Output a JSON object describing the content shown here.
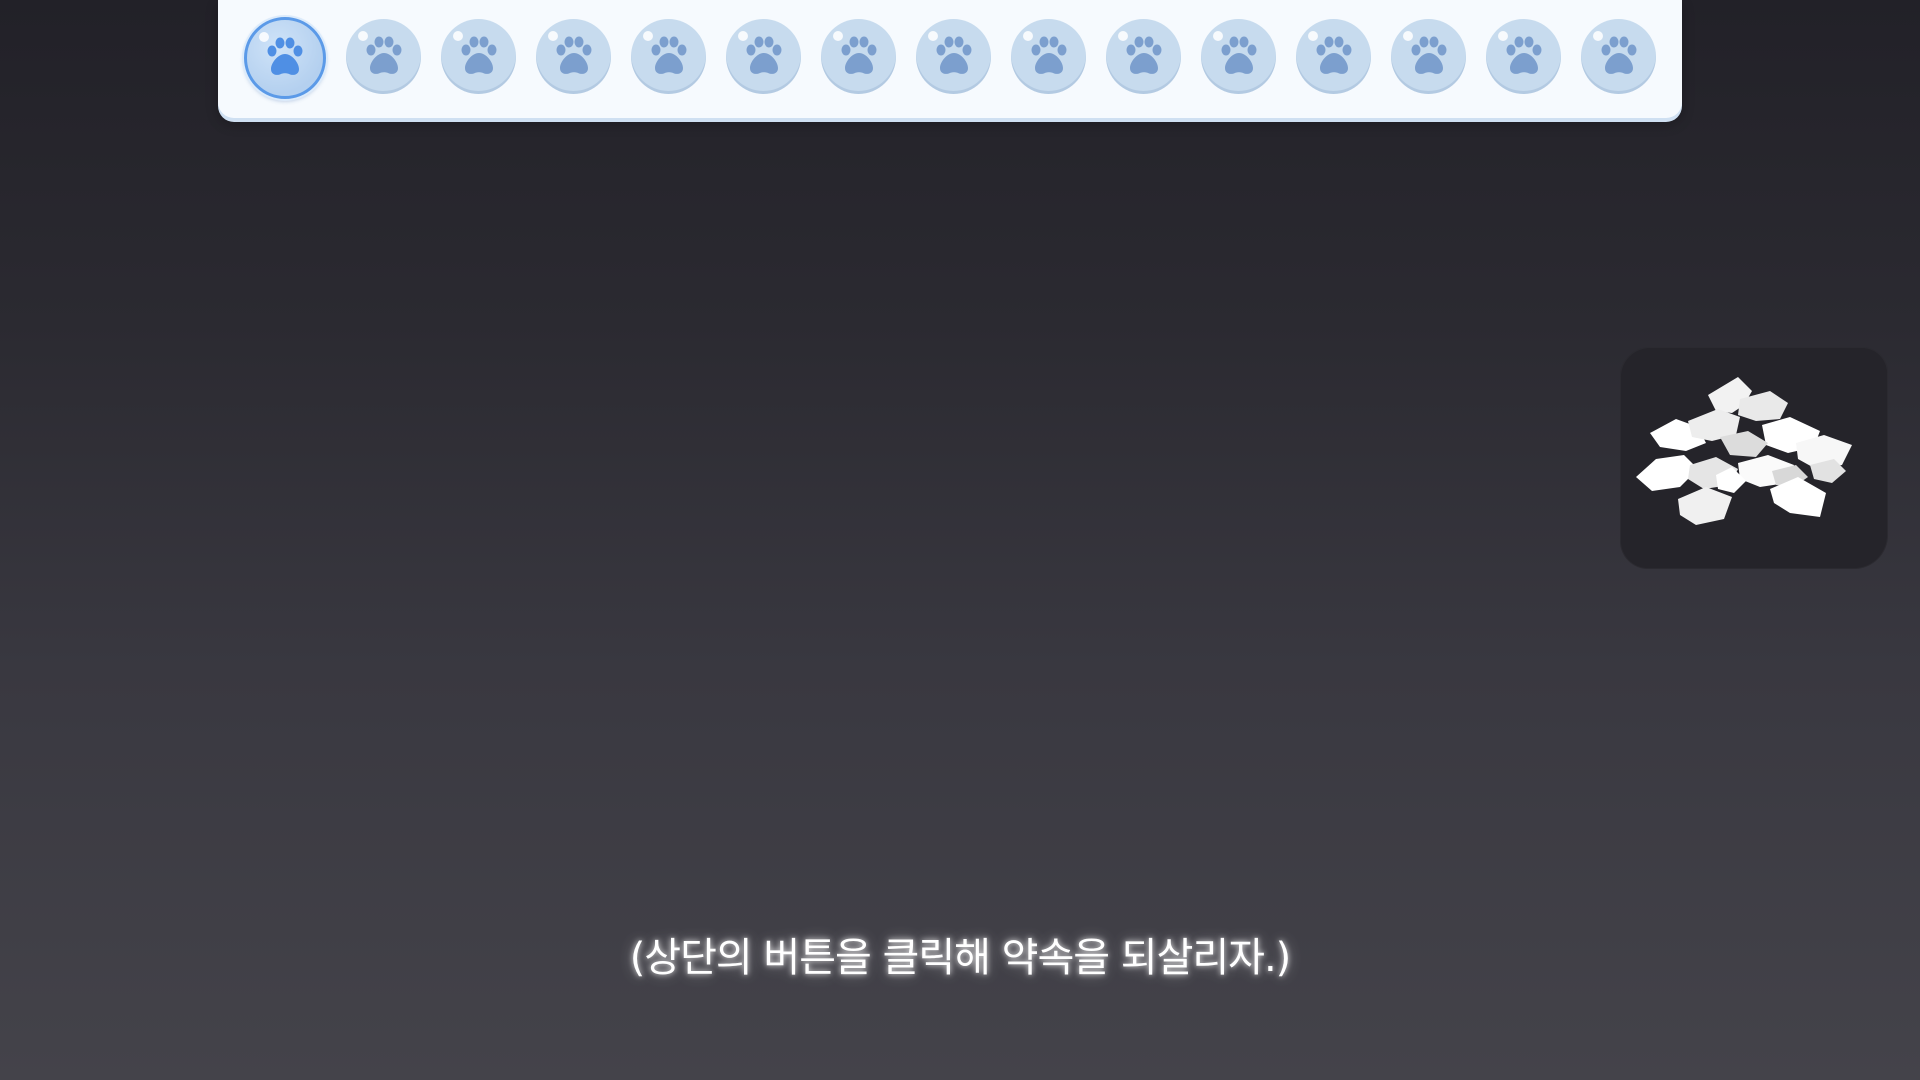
{
  "toolbar": {
    "buttons": [
      {
        "icon": "paw-icon",
        "active": true
      },
      {
        "icon": "paw-icon",
        "active": false
      },
      {
        "icon": "paw-icon",
        "active": false
      },
      {
        "icon": "paw-icon",
        "active": false
      },
      {
        "icon": "paw-icon",
        "active": false
      },
      {
        "icon": "paw-icon",
        "active": false
      },
      {
        "icon": "paw-icon",
        "active": false
      },
      {
        "icon": "paw-icon",
        "active": false
      },
      {
        "icon": "paw-icon",
        "active": false
      },
      {
        "icon": "paw-icon",
        "active": false
      },
      {
        "icon": "paw-icon",
        "active": false
      },
      {
        "icon": "paw-icon",
        "active": false
      },
      {
        "icon": "paw-icon",
        "active": false
      },
      {
        "icon": "paw-icon",
        "active": false
      },
      {
        "icon": "paw-icon",
        "active": false
      }
    ],
    "colors": {
      "active": "#4f8fe4",
      "inactive": "#7c9fce",
      "button_bg": "#c7dbee"
    }
  },
  "side_item": {
    "icon": "torn-paper-pile-icon"
  },
  "subtitle": {
    "text": "(상단의 버튼을 클릭해 약속을 되살리자.)"
  }
}
